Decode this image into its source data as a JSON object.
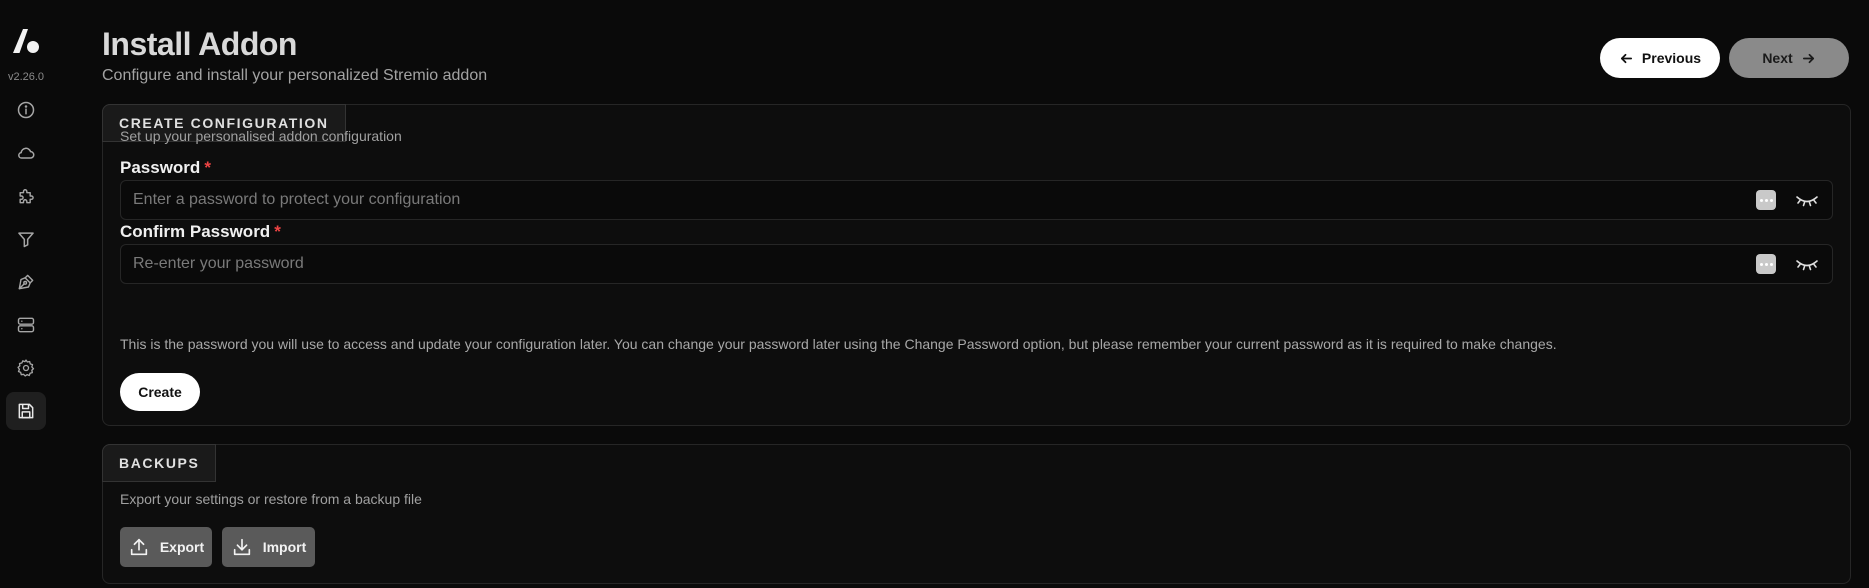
{
  "sidebar": {
    "version": "v2.26.0",
    "items": [
      {
        "icon": "info-icon"
      },
      {
        "icon": "cloud-icon"
      },
      {
        "icon": "puzzle-icon"
      },
      {
        "icon": "filter-icon"
      },
      {
        "icon": "pen-tool-icon"
      },
      {
        "icon": "server-icon"
      },
      {
        "icon": "gear-icon"
      },
      {
        "icon": "save-icon",
        "active": true
      }
    ]
  },
  "header": {
    "title": "Install Addon",
    "subtitle": "Configure and install your personalized Stremio addon",
    "previous_label": "Previous",
    "next_label": "Next"
  },
  "config_card": {
    "tab_label": "CREATE CONFIGURATION",
    "description": "Set up your personalised addon configuration",
    "password_label": "Password",
    "password_placeholder": "Enter a password to protect your configuration",
    "confirm_label": "Confirm Password",
    "confirm_placeholder": "Re-enter your password",
    "required_mark": "*",
    "help_text": "This is the password you will use to access and update your configuration later. You can change your password later using the Change Password option, but please remember your current password as it is required to make changes.",
    "create_label": "Create"
  },
  "backups_card": {
    "tab_label": "BACKUPS",
    "description": "Export your settings or restore from a backup file",
    "export_label": "Export",
    "import_label": "Import"
  },
  "colors": {
    "background": "#0a0a0a",
    "required": "#ef4444",
    "button_gray": "#5a5a5a",
    "button_disabled": "#8a8a8a"
  }
}
